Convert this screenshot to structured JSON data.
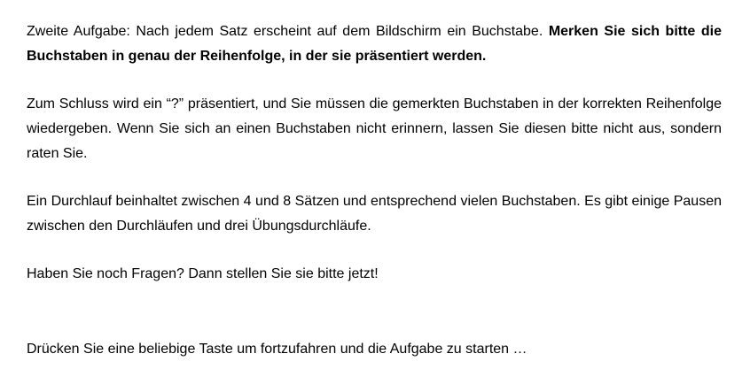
{
  "instructions": {
    "p1_plain": "Zweite Aufgabe: Nach jedem Satz erscheint auf dem Bildschirm ein Buchstabe. ",
    "p1_bold": "Merken Sie sich bitte die Buchstaben  in genau  der Reihenfolge,  in der sie präsentiert  werden.",
    "p2": "Zum Schluss wird ein “?” präsentiert, und Sie müssen die gemerkten Buchstaben in der korrekten Reihenfolge wiedergeben.  Wenn Sie sich an einen Buchstaben nicht erinnern, lassen Sie diesen bitte nicht aus, sondern  raten Sie.",
    "p3": "Ein Durchlauf beinhaltet zwischen 4 und 8 Sätzen und entsprechend vielen Buchstaben. Es gibt einige Pausen zwischen den Durchläufen und drei Übungsdurchläufe.",
    "p4": "Haben Sie noch Fragen? Dann stellen Sie sie bitte jetzt!"
  },
  "continue_prompt": "Drücken Sie eine beliebige Taste um fortzufahren und die Aufgabe zu starten …"
}
